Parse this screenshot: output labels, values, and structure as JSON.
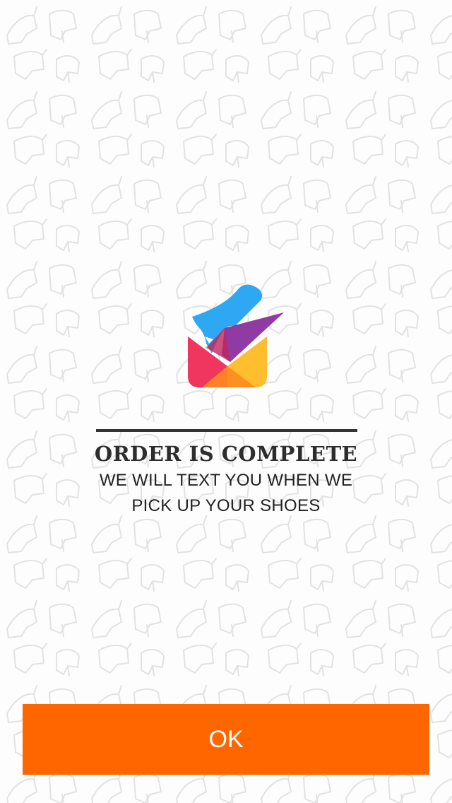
{
  "confirmation": {
    "title": "ORDER IS COMPLETE",
    "message": "WE WILL TEXT YOU WHEN WE\nPICK UP YOUR SHOES"
  },
  "actions": {
    "ok_label": "OK"
  },
  "colors": {
    "accent": "#ff6600",
    "divider": "#333333",
    "text": "#2d2d2d",
    "logo_blue": "#2fa8f3",
    "logo_purple": "#8a2f9e",
    "logo_pink": "#f0365e",
    "logo_yellow": "#ffbe2e",
    "logo_orange": "#ff8a1f"
  },
  "icons": {
    "logo": "shoe-box-logo-icon",
    "background": "shoe-doodle-pattern"
  }
}
